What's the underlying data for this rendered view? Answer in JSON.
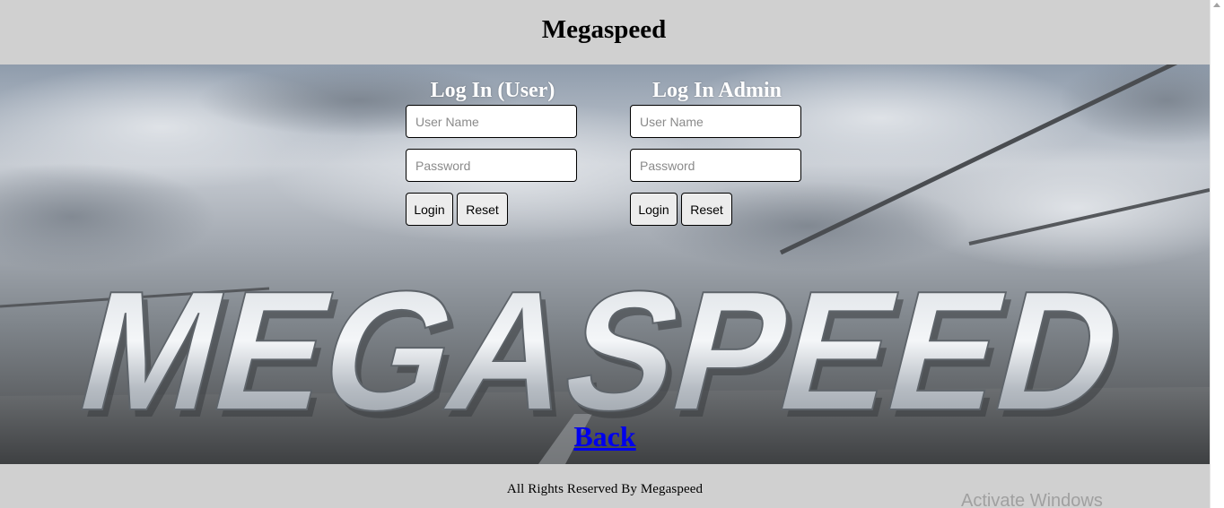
{
  "header": {
    "title": "Megaspeed"
  },
  "banner": {
    "logo_text": "MEGASPEED"
  },
  "user_login": {
    "heading": "Log In (User)",
    "username_placeholder": "User Name",
    "password_placeholder": "Password",
    "login_label": "Login",
    "reset_label": "Reset"
  },
  "admin_login": {
    "heading": "Log In Admin",
    "username_placeholder": "User Name",
    "password_placeholder": "Password",
    "login_label": "Login",
    "reset_label": "Reset"
  },
  "back_link": {
    "label": "Back"
  },
  "footer": {
    "copyright": "All Rights Reserved By Megaspeed",
    "watermark": "Activate Windows"
  },
  "colors": {
    "page_background": "#d0d0d0",
    "link": "#0000ee",
    "heading_on_banner": "#ffffff"
  }
}
